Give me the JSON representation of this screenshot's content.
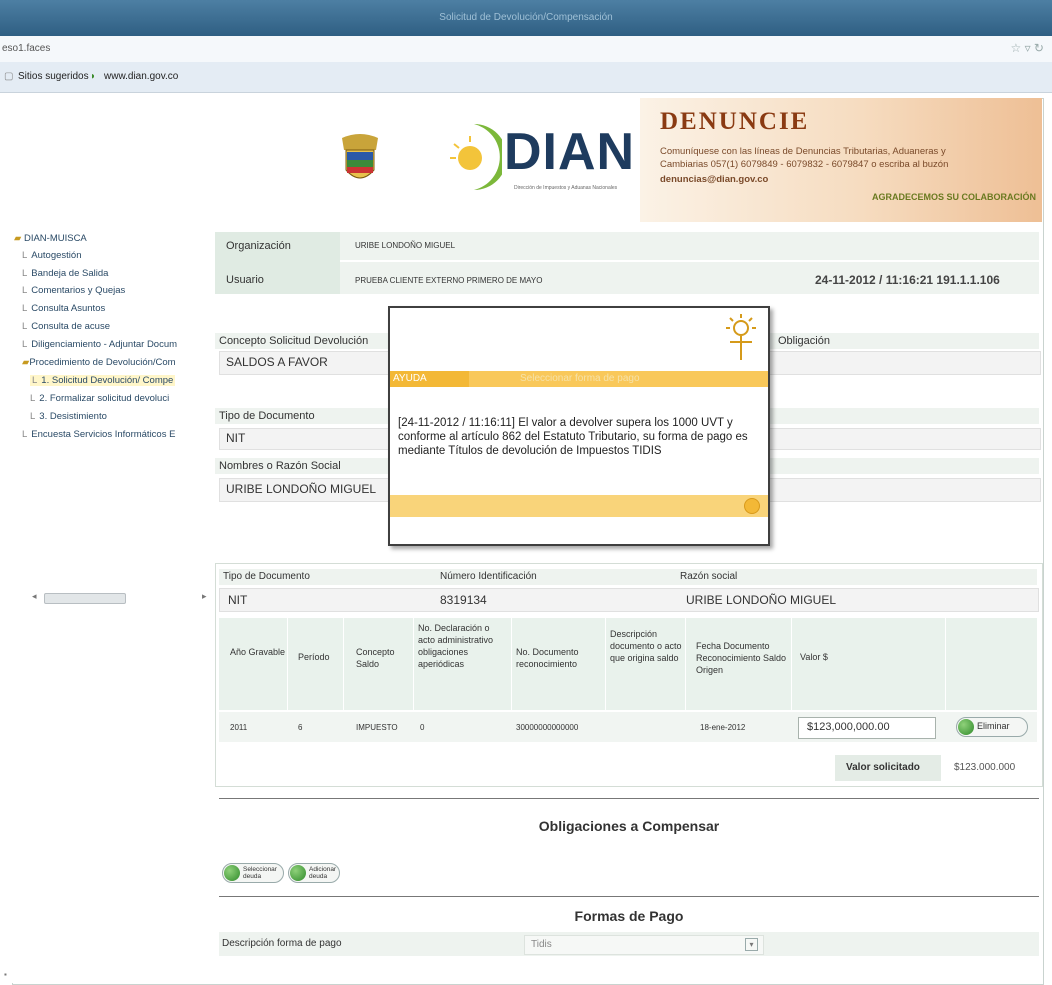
{
  "browser": {
    "window_title": "Solicitud de Devolución/Compensación",
    "url": "eso1.faces",
    "bookmarks": [
      "Sitios sugeridos",
      "www.dian.gov.co"
    ]
  },
  "banner": {
    "logo_text": "DIAN",
    "logo_subtitle": "Dirección de Impuestos y Aduanas Nacionales",
    "denuncie_title": "DENUNCIE",
    "denuncie_line1": "Comuníquese con las líneas de Denuncias Tributarias, Aduaneras y",
    "denuncie_line2": "Cambiarias 057(1) 6079849 - 6079832 - 6079847 o escriba al buzón",
    "denuncie_email": "denuncias@dian.gov.co",
    "denuncie_thanks": "AGRADECEMOS SU COLABORACIÓN"
  },
  "sidebar": {
    "root": "DIAN-MUISCA",
    "items": [
      "Autogestión",
      "Bandeja de Salida",
      "Comentarios y Quejas",
      "Consulta Asuntos",
      "Consulta de acuse",
      "Diligenciamiento - Adjuntar Docum",
      "Procedimiento de Devolución/Com"
    ],
    "subitems": [
      "1. Solicitud Devolución/ Compe",
      "2. Formalizar solicitud devoluci",
      "3. Desistimiento"
    ],
    "last": "Encuesta Servicios Informáticos E"
  },
  "header": {
    "org_label": "Organización",
    "org_value": "URIBE LONDOÑO MIGUEL",
    "user_label": "Usuario",
    "user_value": "PRUEBA CLIENTE EXTERNO PRIMERO DE MAYO",
    "datetime": "24-11-2012 / 11:16:21 191.1.1.106"
  },
  "form": {
    "concepto_label": "Concepto Solicitud Devolución",
    "concepto_value": "SALDOS A FAVOR",
    "obligacion_label": "Obligación",
    "tipo_doc_label": "Tipo de Documento",
    "tipo_doc_value": "NIT",
    "nombre_label": "Nombres o Razón Social",
    "nombre_value": "URIBE LONDOÑO MIGUEL"
  },
  "popup": {
    "tag": "AYUDA",
    "title": "Seleccionar forma de pago",
    "message": "[24-11-2012 / 11:16:11] El valor a devolver supera los 1000 UVT y conforme al artículo 862 del Estatuto Tributario, su forma de pago es mediante Títulos de devolución de Impuestos TIDIS"
  },
  "ident": {
    "tipo_label": "Tipo de Documento",
    "tipo_value": "NIT",
    "num_label": "Número Identificación",
    "num_value": "8319134",
    "razon_label": "Razón social",
    "razon_value": "URIBE LONDOÑO MIGUEL"
  },
  "table": {
    "headers": [
      "Año Gravable",
      "Período",
      "Concepto Saldo",
      "No. Declaración o acto administrativo obligaciones aperiódicas",
      "No. Documento reconocimiento",
      "Descripción documento o acto que origina saldo",
      "Fecha Documento Reconocimiento Saldo Origen",
      "Valor $"
    ],
    "row": [
      "2011",
      "6",
      "IMPUESTO",
      "0",
      "30000000000000",
      "",
      "18-ene-2012"
    ],
    "valor_input": "$123,000,000.00",
    "delete_label": "Eliminar"
  },
  "summary": {
    "label": "Valor solicitado",
    "value": "$123.000.000"
  },
  "obligaciones": {
    "title": "Obligaciones a Compensar",
    "select_btn": "Seleccionar deuda",
    "add_btn": "Adicionar deuda"
  },
  "pago": {
    "title": "Formas de Pago",
    "label": "Descripción forma de pago",
    "value": "Tidis"
  }
}
